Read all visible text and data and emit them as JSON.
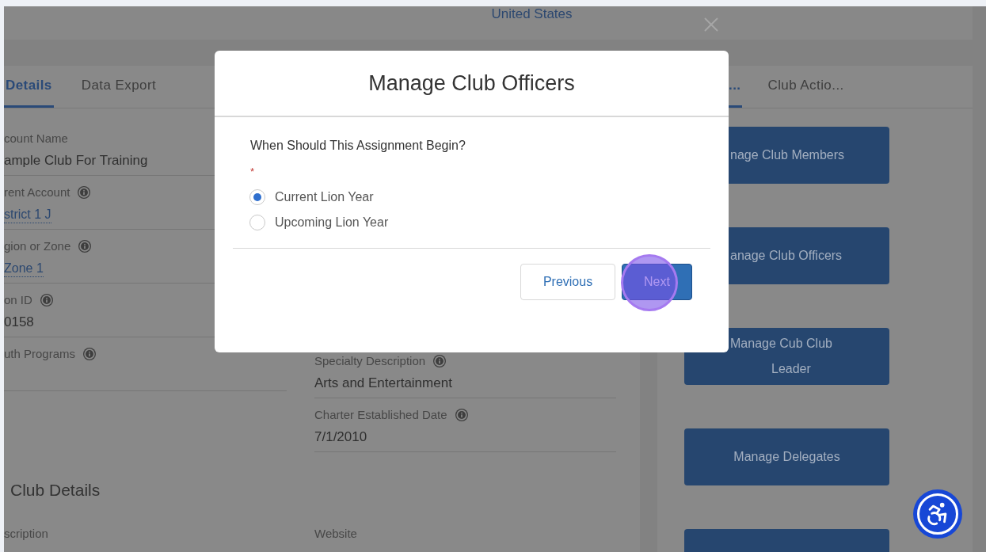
{
  "header": {
    "country": "United States"
  },
  "details_panel": {
    "tabs": [
      {
        "label": "Details",
        "selected": true
      },
      {
        "label": "Data Export",
        "selected": false
      }
    ],
    "fields_left": [
      {
        "label": "count Name",
        "info": false,
        "value": "ample Club For Training",
        "kind": "text"
      },
      {
        "label": "rent Account",
        "info": true,
        "value": "strict 1 J",
        "kind": "link"
      },
      {
        "label": "gion or Zone",
        "info": true,
        "value": "Zone 1",
        "kind": "link"
      },
      {
        "label": "on ID",
        "info": true,
        "value": "0158",
        "kind": "text"
      },
      {
        "label": "uth Programs",
        "info": true,
        "kind": "empty"
      }
    ],
    "fields_right": [
      {
        "label": "Specialty Description",
        "info": true,
        "value": "Arts and Entertainment",
        "kind": "text"
      },
      {
        "label": "Charter Established Date",
        "info": true,
        "value": "7/1/2010",
        "kind": "text"
      }
    ],
    "section": {
      "title": "Club Details",
      "labels": [
        "scription",
        "Website"
      ]
    }
  },
  "actions_panel": {
    "tabs": [
      {
        "label": "...",
        "selected": true
      },
      {
        "label": "Club Actio...",
        "selected": false
      }
    ],
    "buttons": [
      {
        "lines": [
          "nage Club Members"
        ],
        "covered": true
      },
      {
        "lines": [
          "anage Club Officers"
        ],
        "covered": true
      },
      {
        "lines": [
          "Manage Cub Club",
          "Leader"
        ],
        "covered": true
      },
      {
        "lines": [
          "Manage Delegates"
        ],
        "covered": false
      }
    ]
  },
  "modal": {
    "title": "Manage Club Officers",
    "question": "When Should This Assignment Begin?",
    "required_mark": "*",
    "options": [
      {
        "label": "Current Lion Year",
        "selected": true
      },
      {
        "label": "Upcoming Lion Year",
        "selected": false
      }
    ],
    "buttons": [
      {
        "label": "Previous",
        "kind": "secondary",
        "highlighted": false
      },
      {
        "label": "Next",
        "kind": "primary",
        "highlighted": true
      }
    ]
  }
}
